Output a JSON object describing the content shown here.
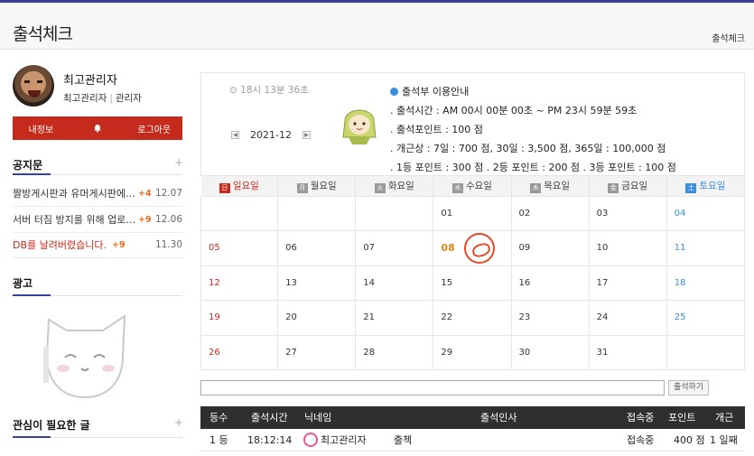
{
  "header": {
    "title": "출석체크",
    "breadcrumb": "출석체크"
  },
  "user": {
    "name": "최고관리자",
    "nickname": "최고관리자",
    "role": "관리자"
  },
  "user_buttons": {
    "profile": "내정보",
    "logout": "로그아웃"
  },
  "notice": {
    "title": "공지문",
    "items": [
      {
        "title": "짤방게시판과 유머게시판에…",
        "count": "+4",
        "date": "12.07",
        "red": false
      },
      {
        "title": "서버 터짐 방지를 위해 업로…",
        "count": "+9",
        "date": "12.06",
        "red": false
      },
      {
        "title": "DB를 날려버렸습니다.",
        "count": "+9",
        "date": "11.30",
        "red": true
      }
    ]
  },
  "ad": {
    "title": "광고"
  },
  "attention": {
    "title": "관심이 필요한 글"
  },
  "clock": "18시 13분 36초",
  "calendar_month": "2021-12",
  "info": {
    "title": "출석부 이용안내",
    "lines": [
      ". 출석시간 : AM 00시 00분 00초 ~ PM 23시 59분 59초",
      ". 출석포인트 : 100 점",
      ". 개근상 : 7일 : 700 점,   30일 : 3,500 점,  365일 : 100,000 점",
      ". 1등 포인트 : 300 점  . 2등 포인트 : 200 점  . 3등 포인트 : 100 점"
    ]
  },
  "weekdays": [
    {
      "badge": "日",
      "label": "일요일"
    },
    {
      "badge": "月",
      "label": "월요일"
    },
    {
      "badge": "火",
      "label": "화요일"
    },
    {
      "badge": "水",
      "label": "수요일"
    },
    {
      "badge": "木",
      "label": "목요일"
    },
    {
      "badge": "金",
      "label": "금요일"
    },
    {
      "badge": "土",
      "label": "토요일"
    }
  ],
  "weeks": [
    [
      "",
      "",
      "",
      "01",
      "02",
      "03",
      "04"
    ],
    [
      "05",
      "06",
      "07",
      "08",
      "09",
      "10",
      "11"
    ],
    [
      "12",
      "13",
      "14",
      "15",
      "16",
      "17",
      "18"
    ],
    [
      "19",
      "20",
      "21",
      "22",
      "23",
      "24",
      "25"
    ],
    [
      "26",
      "27",
      "28",
      "29",
      "30",
      "31",
      ""
    ]
  ],
  "today": "08",
  "greeting": {
    "placeholder": "",
    "button": "출석하기"
  },
  "table": {
    "headers": [
      "등수",
      "출석시간",
      "닉네임",
      "출석인사",
      "접속중",
      "포인트",
      "개근"
    ],
    "rows": [
      {
        "rank": "1 등",
        "time": "18:12:14",
        "nick": "최고관리자",
        "message": "출첵",
        "status": "접속중",
        "points": "400 점",
        "streak": "1 일째"
      }
    ]
  },
  "colors": {
    "accent": "#3b3f9e",
    "button_red": "#c42b1c",
    "sunday": "#c42b1c",
    "saturday": "#3a8ee0",
    "today": "#e08a1a"
  }
}
